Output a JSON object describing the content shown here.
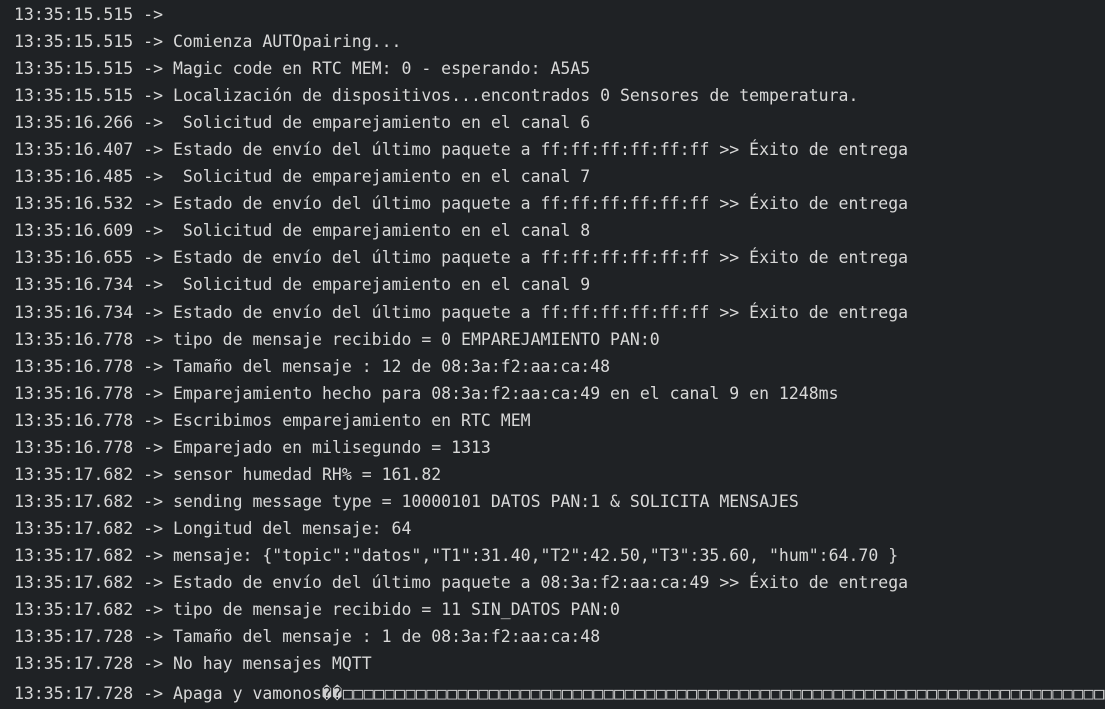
{
  "terminal": {
    "arrow": " -> ",
    "lines": [
      {
        "ts": "13:35:15.515",
        "msg": ""
      },
      {
        "ts": "13:35:15.515",
        "msg": "Comienza AUTOpairing..."
      },
      {
        "ts": "13:35:15.515",
        "msg": "Magic code en RTC MEM: 0 - esperando: A5A5"
      },
      {
        "ts": "13:35:15.515",
        "msg": "Localización de dispositivos...encontrados 0 Sensores de temperatura."
      },
      {
        "ts": "13:35:16.266",
        "msg": " Solicitud de emparejamiento en el canal 6"
      },
      {
        "ts": "13:35:16.407",
        "msg": "Estado de envío del último paquete a ff:ff:ff:ff:ff:ff >> Éxito de entrega"
      },
      {
        "ts": "13:35:16.485",
        "msg": " Solicitud de emparejamiento en el canal 7"
      },
      {
        "ts": "13:35:16.532",
        "msg": "Estado de envío del último paquete a ff:ff:ff:ff:ff:ff >> Éxito de entrega"
      },
      {
        "ts": "13:35:16.609",
        "msg": " Solicitud de emparejamiento en el canal 8"
      },
      {
        "ts": "13:35:16.655",
        "msg": "Estado de envío del último paquete a ff:ff:ff:ff:ff:ff >> Éxito de entrega"
      },
      {
        "ts": "13:35:16.734",
        "msg": " Solicitud de emparejamiento en el canal 9"
      },
      {
        "ts": "13:35:16.734",
        "msg": "Estado de envío del último paquete a ff:ff:ff:ff:ff:ff >> Éxito de entrega"
      },
      {
        "ts": "13:35:16.778",
        "msg": "tipo de mensaje recibido = 0 EMPAREJAMIENTO PAN:0"
      },
      {
        "ts": "13:35:16.778",
        "msg": "Tamaño del mensaje : 12 de 08:3a:f2:aa:ca:48"
      },
      {
        "ts": "13:35:16.778",
        "msg": "Emparejamiento hecho para 08:3a:f2:aa:ca:49 en el canal 9 en 1248ms"
      },
      {
        "ts": "13:35:16.778",
        "msg": "Escribimos emparejamiento en RTC MEM"
      },
      {
        "ts": "13:35:16.778",
        "msg": "Emparejado en milisegundo = 1313"
      },
      {
        "ts": "13:35:17.682",
        "msg": "sensor humedad RH% = 161.82"
      },
      {
        "ts": "13:35:17.682",
        "msg": "sending message type = 10000101 DATOS PAN:1 & SOLICITA MENSAJES"
      },
      {
        "ts": "13:35:17.682",
        "msg": "Longitud del mensaje: 64"
      },
      {
        "ts": "13:35:17.682",
        "msg": "mensaje: {\"topic\":\"datos\",\"T1\":31.40,\"T2\":42.50,\"T3\":35.60, \"hum\":64.70 }"
      },
      {
        "ts": "13:35:17.682",
        "msg": "Estado de envío del último paquete a 08:3a:f2:aa:ca:49 >> Éxito de entrega"
      },
      {
        "ts": "13:35:17.682",
        "msg": "tipo de mensaje recibido = 11 SIN_DATOS PAN:0"
      },
      {
        "ts": "13:35:17.728",
        "msg": "Tamaño del mensaje : 1 de 08:3a:f2:aa:ca:48"
      },
      {
        "ts": "13:35:17.728",
        "msg": "No hay mensajes MQTT"
      }
    ],
    "last_line": {
      "ts": "13:35:17.728",
      "msg": "Apaga y vamonos",
      "garbage": "��□□□□□□□□□□□□□□□□□□□□□□□□□□□□□□□□□□□□□□□□□□□□□□□□□□□□□□□□□□□□□□□□□□□□□□□□□□□□□□□□□□□"
    }
  }
}
